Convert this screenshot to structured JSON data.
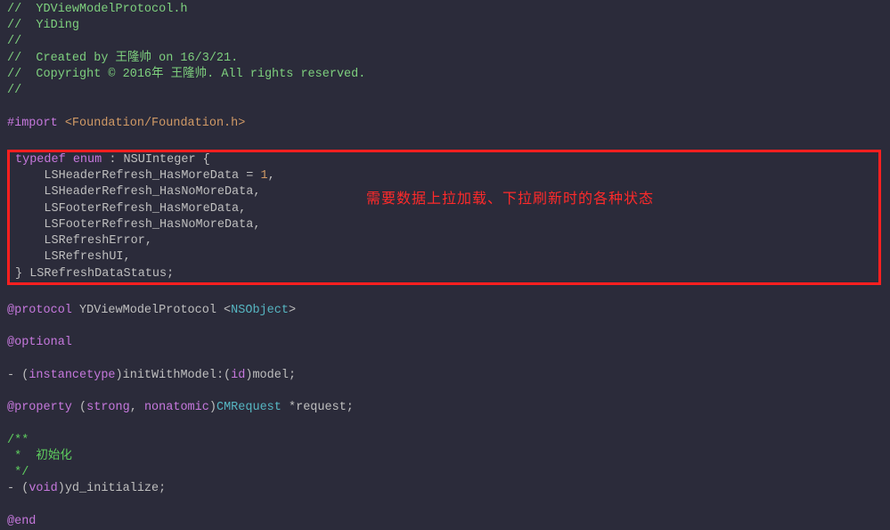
{
  "header": {
    "c1": "//  YDViewModelProtocol.h",
    "c2": "//  YiDing",
    "c3": "//",
    "c4": "//  Created by 王隆帅 on 16/3/21.",
    "c5": "//  Copyright © 2016年 王隆帅. All rights reserved.",
    "c6": "//"
  },
  "import": {
    "directive": "#import",
    "path": "<Foundation/Foundation.h>"
  },
  "enum": {
    "typedef": "typedef",
    "enum_kw": "enum",
    "colon_type": " : NSUInteger {",
    "m1": "    LSHeaderRefresh_HasMoreData = ",
    "one": "1",
    "m1_tail": ",",
    "m2": "    LSHeaderRefresh_HasNoMoreData,",
    "m3": "    LSFooterRefresh_HasMoreData,",
    "m4": "    LSFooterRefresh_HasNoMoreData,",
    "m5": "    LSRefreshError,",
    "m6": "    LSRefreshUI,",
    "close": "} LSRefreshDataStatus;"
  },
  "annotation": "需要数据上拉加载、下拉刷新时的各种状态",
  "protocol": {
    "at": "@protocol",
    "name": " YDViewModelProtocol <",
    "ns": "NSObject",
    "close": ">"
  },
  "optional": "@optional",
  "method1": {
    "dash": "- (",
    "instancetype": "instancetype",
    "mid": ")initWithModel:(",
    "id": "id",
    "tail": ")model;"
  },
  "property": {
    "at": "@property",
    "open": " (",
    "strong": "strong",
    "comma": ", ",
    "nonatomic": "nonatomic",
    "close": ")",
    "type": "CMRequest",
    "tail": " *request;"
  },
  "doc": {
    "l1": "/**",
    "l2": " *  初始化",
    "l3": " */"
  },
  "method2": {
    "dash": "- (",
    "void": "void",
    "tail": ")yd_initialize;"
  },
  "end": "@end"
}
